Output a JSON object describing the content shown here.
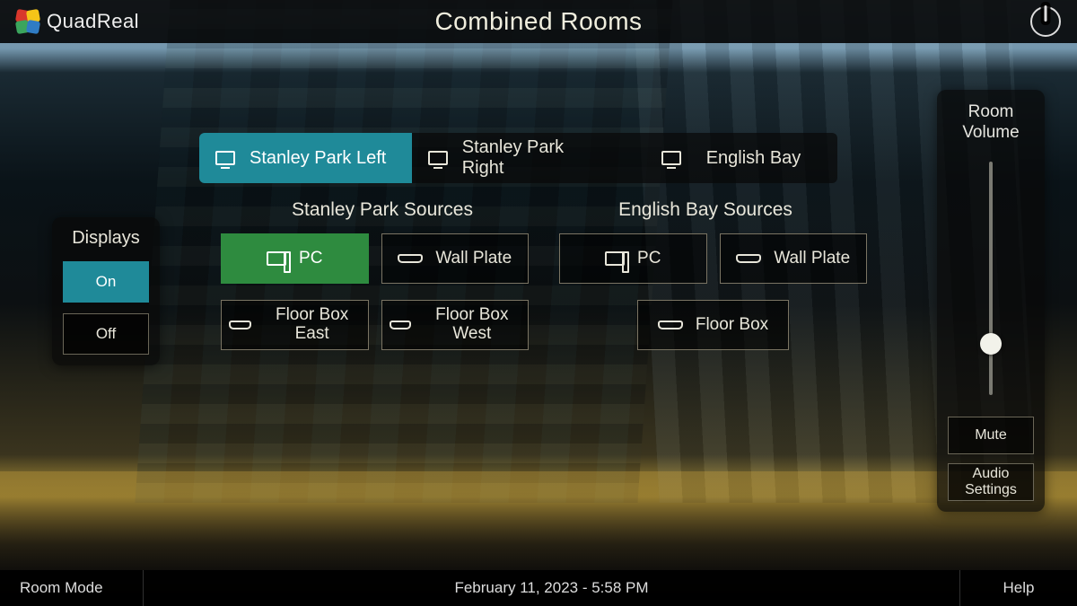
{
  "brand": "QuadReal",
  "title": "Combined Rooms",
  "displays": {
    "heading": "Displays",
    "on_label": "On",
    "off_label": "Off",
    "state": "on"
  },
  "tabs": [
    {
      "label": "Stanley Park Left",
      "active": true
    },
    {
      "label": "Stanley Park Right",
      "active": false
    },
    {
      "label": "English Bay",
      "active": false
    }
  ],
  "source_groups": {
    "left_heading": "Stanley Park Sources",
    "right_heading": "English Bay Sources",
    "stanley_park": [
      {
        "id": "sp-pc",
        "label": "PC",
        "icon": "pc",
        "selected": true
      },
      {
        "id": "sp-wallplate",
        "label": "Wall Plate",
        "icon": "hdmi",
        "selected": false
      },
      {
        "id": "sp-floor-east",
        "label": "Floor Box East",
        "icon": "hdmi",
        "selected": false
      },
      {
        "id": "sp-floor-west",
        "label": "Floor Box West",
        "icon": "hdmi",
        "selected": false
      }
    ],
    "english_bay": [
      {
        "id": "eb-pc",
        "label": "PC",
        "icon": "pc",
        "selected": false
      },
      {
        "id": "eb-wallplate",
        "label": "Wall Plate",
        "icon": "hdmi",
        "selected": false
      },
      {
        "id": "eb-floorbox",
        "label": "Floor Box",
        "icon": "hdmi",
        "selected": false
      }
    ]
  },
  "volume": {
    "heading": "Room Volume",
    "level_percent": 22,
    "mute_label": "Mute",
    "settings_label": "Audio Settings"
  },
  "footer": {
    "room_mode": "Room Mode",
    "datetime": "February 11, 2023 - 5:58 PM",
    "help": "Help"
  }
}
